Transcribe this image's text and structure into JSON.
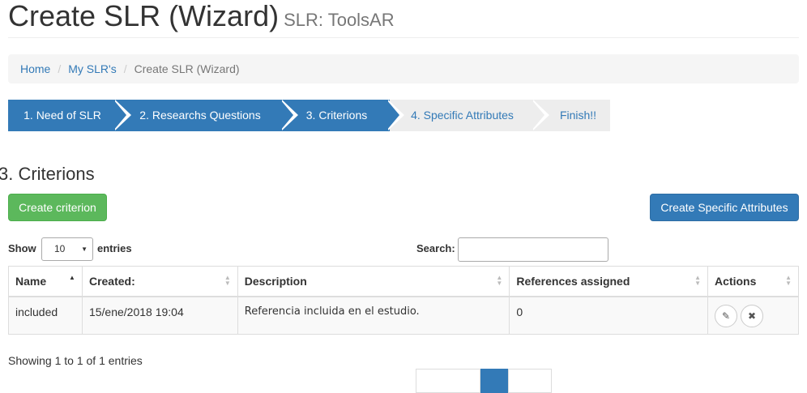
{
  "header": {
    "title": "Create SLR (Wizard)",
    "subtitle": "SLR: ToolsAR"
  },
  "breadcrumb": {
    "home": "Home",
    "my_slrs": "My SLR's",
    "current": "Create SLR (Wizard)",
    "separator": "/"
  },
  "wizard": {
    "steps": [
      {
        "label": "1. Need of SLR",
        "state": "done"
      },
      {
        "label": "2. Researchs Questions",
        "state": "done"
      },
      {
        "label": "3. Criterions",
        "state": "current"
      },
      {
        "label": "4. Specific Attributes",
        "state": "todo"
      },
      {
        "label": "Finish!!",
        "state": "todo"
      }
    ]
  },
  "section": {
    "title": "3. Criterions"
  },
  "buttons": {
    "create_criterion": "Create criterion",
    "create_specific_attributes": "Create Specific Attributes"
  },
  "table_controls": {
    "show_label": "Show",
    "page_length": "10",
    "entries_label": "entries",
    "search_label": "Search:",
    "search_value": ""
  },
  "table": {
    "columns": [
      "Name",
      "Created:",
      "Description",
      "References assigned",
      "Actions"
    ],
    "rows": [
      {
        "name": "included",
        "created": "15/ene/2018 19:04",
        "description": "Referencia incluida en el estudio.",
        "references_assigned": "0"
      }
    ]
  },
  "info": "Showing 1 to 1 of 1 entries",
  "icons": {
    "edit": "edit-icon",
    "delete": "delete-icon",
    "sort": "sort-icon",
    "caret": "caret-down-icon"
  },
  "colors": {
    "primary": "#337ab7",
    "success": "#5cb85c",
    "step_inactive": "#ededed"
  }
}
